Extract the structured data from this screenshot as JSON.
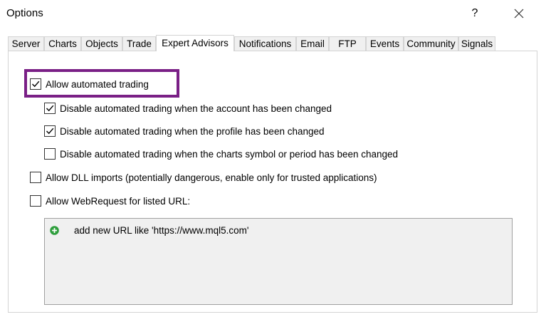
{
  "window": {
    "title": "Options",
    "help_label": "?"
  },
  "tabs": [
    {
      "label": "Server"
    },
    {
      "label": "Charts"
    },
    {
      "label": "Objects"
    },
    {
      "label": "Trade"
    },
    {
      "label": "Expert Advisors"
    },
    {
      "label": "Notifications"
    },
    {
      "label": "Email"
    },
    {
      "label": "FTP"
    },
    {
      "label": "Events"
    },
    {
      "label": "Community"
    },
    {
      "label": "Signals"
    }
  ],
  "active_tab": "Expert Advisors",
  "options": {
    "allow_automated_trading": {
      "label": "Allow automated trading",
      "checked": true
    },
    "disable_account_changed": {
      "label": "Disable automated trading when the account has been changed",
      "checked": true
    },
    "disable_profile_changed": {
      "label": "Disable automated trading when the profile has been changed",
      "checked": true
    },
    "disable_symbol_changed": {
      "label": "Disable automated trading when the charts symbol or period has been changed",
      "checked": false
    },
    "allow_dll_imports": {
      "label": "Allow DLL imports (potentially dangerous, enable only for trusted applications)",
      "checked": false
    },
    "allow_webrequest": {
      "label": "Allow WebRequest for listed URL:",
      "checked": false
    }
  },
  "url_list": {
    "add_label": "add new URL like 'https://www.mql5.com'"
  },
  "colors": {
    "highlight_border": "#7a1f86",
    "plus_icon": "#2e9e3c",
    "list_background": "#f0f0f0"
  }
}
